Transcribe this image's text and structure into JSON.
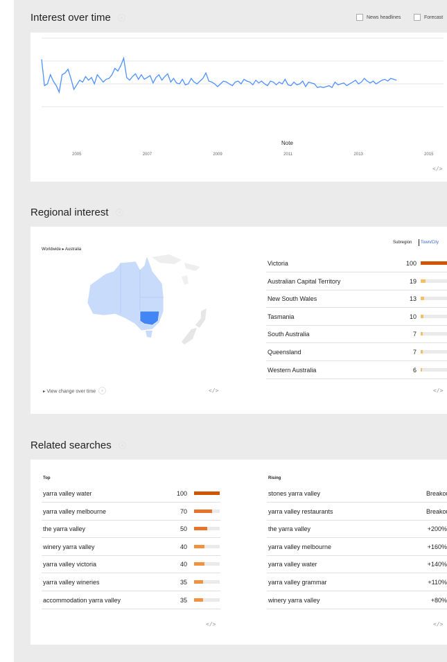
{
  "interest": {
    "title": "Interest over time",
    "news_headlines": "News headlines",
    "forecast": "Forecast",
    "note": "Note",
    "embed": "</>"
  },
  "chart_data": {
    "type": "line",
    "x": [
      "2004-01",
      "2004-02",
      "2004-03",
      "2004-04",
      "2004-05",
      "2004-06",
      "2004-07",
      "2004-08",
      "2004-09",
      "2004-10",
      "2004-11",
      "2004-12",
      "2005-01",
      "2005-02",
      "2005-03",
      "2005-04",
      "2005-05",
      "2005-06",
      "2005-07",
      "2005-08",
      "2005-09",
      "2005-10",
      "2005-11",
      "2005-12",
      "2006-01",
      "2006-02",
      "2006-03",
      "2006-04",
      "2006-05",
      "2006-06",
      "2006-07",
      "2006-08",
      "2006-09",
      "2006-10",
      "2006-11",
      "2006-12",
      "2007-01",
      "2007-02",
      "2007-03",
      "2007-04",
      "2007-05",
      "2007-06",
      "2007-07",
      "2007-08",
      "2007-09",
      "2007-10",
      "2007-11",
      "2007-12",
      "2008-01",
      "2008-02",
      "2008-03",
      "2008-04",
      "2008-05",
      "2008-06",
      "2008-07",
      "2008-08",
      "2008-09",
      "2008-10",
      "2008-11",
      "2008-12",
      "2009-01",
      "2009-02",
      "2009-03",
      "2009-04",
      "2009-05",
      "2009-06",
      "2009-07",
      "2009-08",
      "2009-09",
      "2009-10",
      "2009-11",
      "2009-12",
      "2010-01",
      "2010-02",
      "2010-03",
      "2010-04",
      "2010-05",
      "2010-06",
      "2010-07",
      "2010-08",
      "2010-09",
      "2010-10",
      "2010-11",
      "2010-12",
      "2011-01",
      "2011-02",
      "2011-03",
      "2011-04",
      "2011-05",
      "2011-06",
      "2011-07",
      "2011-08",
      "2011-09",
      "2011-10",
      "2011-11",
      "2011-12",
      "2012-01",
      "2012-02",
      "2012-03",
      "2012-04",
      "2012-05",
      "2012-06",
      "2012-07",
      "2012-08",
      "2012-09",
      "2012-10",
      "2012-11",
      "2012-12",
      "2013-01",
      "2013-02",
      "2013-03",
      "2013-04",
      "2013-05",
      "2013-06",
      "2013-07",
      "2013-08",
      "2013-09",
      "2013-10",
      "2013-11",
      "2013-12",
      "2014-01",
      "2014-02",
      "2014-03",
      "2014-04",
      "2014-05",
      "2014-06",
      "2014-07",
      "2014-08",
      "2014-09",
      "2014-10",
      "2014-11",
      "2014-12",
      "2015-01",
      "2015-02",
      "2015-03",
      "2015-04",
      "2015-05",
      "2015-06"
    ],
    "values": [
      77,
      48,
      50,
      60,
      53,
      48,
      41,
      60,
      62,
      66,
      56,
      44,
      49,
      54,
      52,
      58,
      54,
      57,
      50,
      60,
      56,
      52,
      55,
      56,
      60,
      67,
      64,
      70,
      78,
      57,
      54,
      58,
      61,
      55,
      60,
      55,
      57,
      59,
      51,
      57,
      60,
      54,
      58,
      61,
      52,
      56,
      51,
      50,
      55,
      49,
      50,
      56,
      52,
      50,
      53,
      56,
      62,
      53,
      52,
      50,
      47,
      50,
      53,
      52,
      50,
      48,
      52,
      53,
      50,
      55,
      53,
      52,
      49,
      54,
      51,
      53,
      50,
      48,
      53,
      52,
      49,
      52,
      50,
      55,
      49,
      48,
      52,
      49,
      50,
      53,
      47,
      52,
      51,
      50,
      46,
      47,
      46,
      47,
      48,
      46,
      52,
      49,
      50,
      51,
      48,
      50,
      52,
      54,
      50,
      52,
      56,
      53,
      51,
      53,
      50,
      52,
      54,
      55,
      53,
      56,
      55,
      54
    ],
    "ylim": [
      0,
      100
    ],
    "x_tick_labels": [
      "2005",
      "2007",
      "2009",
      "2011",
      "2013",
      "2015"
    ],
    "grid": true,
    "color": "#4d90fe"
  },
  "regional": {
    "title": "Regional interest",
    "breadcrumb": "Worldwide ▸ Australia",
    "toggle_subregion": "Subregion",
    "toggle_town": "Town/City",
    "view_change": "View change over time",
    "embed": "</>",
    "rows": [
      {
        "label": "Victoria",
        "value": "100",
        "num": 100
      },
      {
        "label": "Australian Capital Territory",
        "value": "19",
        "num": 19
      },
      {
        "label": "New South Wales",
        "value": "13",
        "num": 13
      },
      {
        "label": "Tasmania",
        "value": "10",
        "num": 10
      },
      {
        "label": "South Australia",
        "value": "7",
        "num": 7
      },
      {
        "label": "Queensland",
        "value": "7",
        "num": 7
      },
      {
        "label": "Western Australia",
        "value": "6",
        "num": 6
      }
    ]
  },
  "related": {
    "title": "Related searches",
    "top_label": "Top",
    "rising_label": "Rising",
    "embed": "</>",
    "top": [
      {
        "label": "yarra valley water",
        "value": "100",
        "num": 100
      },
      {
        "label": "yarra valley melbourne",
        "value": "70",
        "num": 70
      },
      {
        "label": "the yarra valley",
        "value": "50",
        "num": 50
      },
      {
        "label": "winery yarra valley",
        "value": "40",
        "num": 40
      },
      {
        "label": "yarra valley victoria",
        "value": "40",
        "num": 40
      },
      {
        "label": "yarra valley wineries",
        "value": "35",
        "num": 35
      },
      {
        "label": "accommodation yarra valley",
        "value": "35",
        "num": 35
      }
    ],
    "rising": [
      {
        "label": "stones yarra valley",
        "value": "Breakout"
      },
      {
        "label": "yarra valley restaurants",
        "value": "Breakout"
      },
      {
        "label": "the yarra valley",
        "value": "+200%"
      },
      {
        "label": "yarra valley melbourne",
        "value": "+160%"
      },
      {
        "label": "yarra valley water",
        "value": "+140%"
      },
      {
        "label": "yarra valley grammar",
        "value": "+110%"
      },
      {
        "label": "winery yarra valley",
        "value": "+80%"
      }
    ]
  },
  "colors": {
    "bar_high": "#d35400",
    "bar_mid": "#f0923f",
    "bar_low": "#f4c060",
    "link": "#3366cc"
  }
}
